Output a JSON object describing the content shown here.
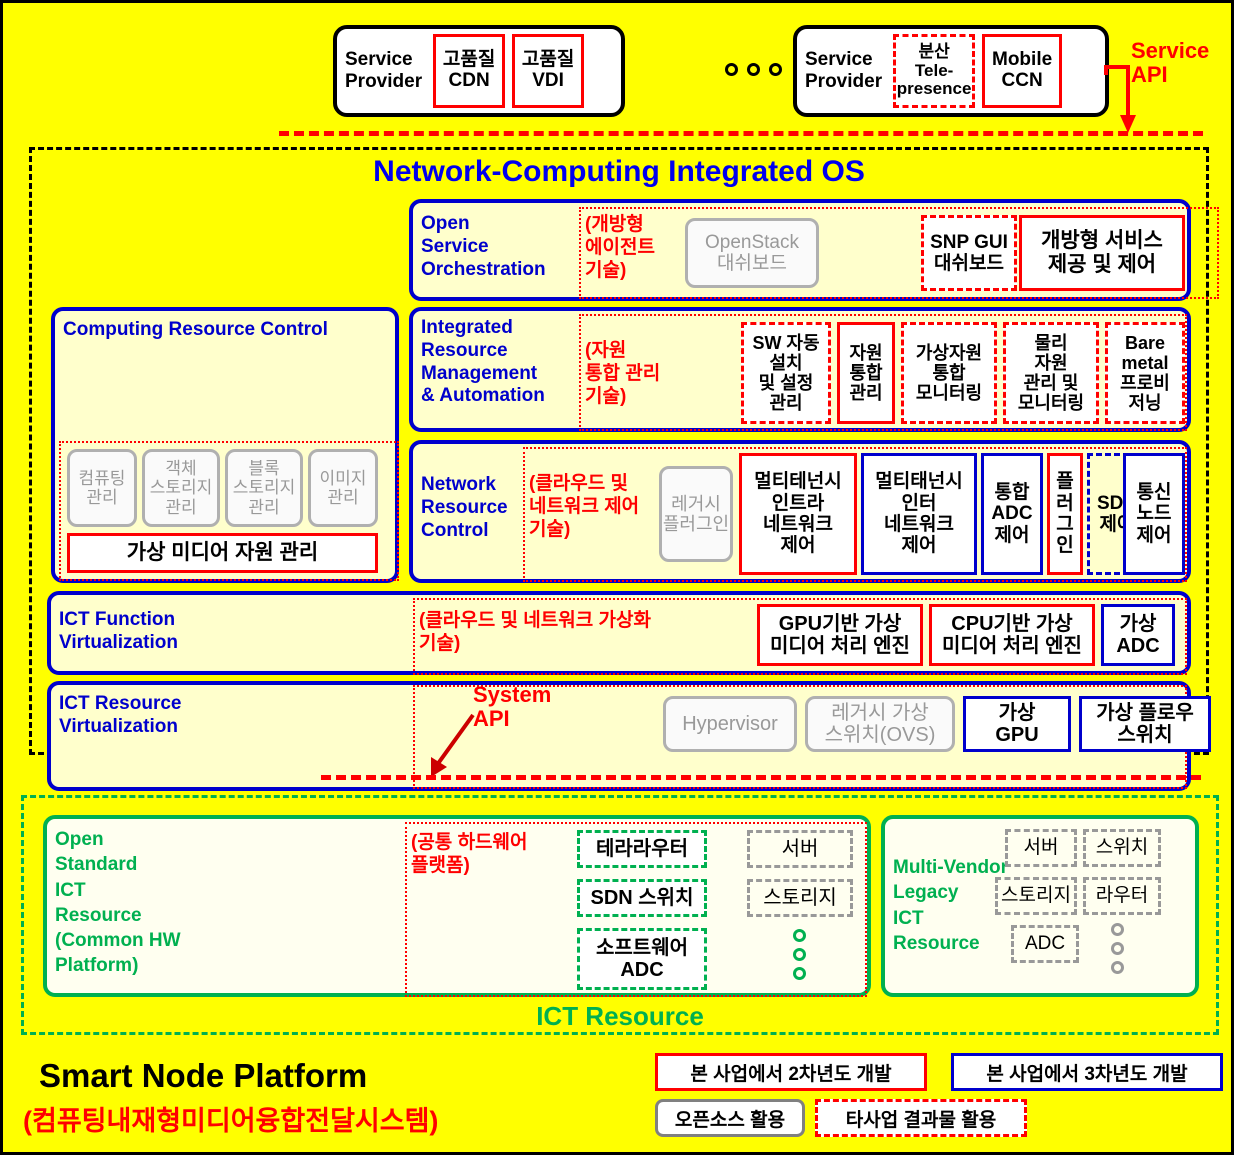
{
  "service_providers": [
    {
      "label": "Service\nProvider",
      "items": [
        {
          "text": "고품질\nCDN",
          "style": "red-solid"
        },
        {
          "text": "고품질\nVDI",
          "style": "red-solid"
        }
      ]
    },
    {
      "label": "Service\nProvider",
      "items": [
        {
          "text": "분산\nTele-\npresence",
          "style": "red-dashed"
        },
        {
          "text": "Mobile\nCCN",
          "style": "red-solid"
        }
      ]
    }
  ],
  "ellipsis": "○ ○ ○",
  "service_api_label": "Service\nAPI",
  "system_api_label": "System\nAPI",
  "os": {
    "title": "Network-Computing Integrated OS",
    "layers": {
      "open_service_orchestration": {
        "title": "Open\nService\nOrchestration",
        "note": "(개방형\n에이전트\n기술)",
        "items": [
          {
            "text": "OpenStack\n대쉬보드",
            "style": "gray"
          },
          {
            "text": "SNP GUI\n대쉬보드",
            "style": "red-dashed"
          },
          {
            "text": "개방형 서비스\n제공 및 제어",
            "style": "red-solid"
          }
        ]
      },
      "computing_resource_control": {
        "title": "Computing Resource Control",
        "items": [
          {
            "text": "컴퓨팅\n관리",
            "style": "gray"
          },
          {
            "text": "객체\n스토리지\n관리",
            "style": "gray"
          },
          {
            "text": "블록\n스토리지\n관리",
            "style": "gray"
          },
          {
            "text": "이미지\n관리",
            "style": "gray"
          }
        ],
        "wide_item": {
          "text": "가상 미디어 자원 관리",
          "style": "red-solid"
        }
      },
      "integrated_resource_management": {
        "title": "Integrated\nResource\nManagement\n& Automation",
        "note": "(자원\n통합 관리\n기술)",
        "items": [
          {
            "text": "SW 자동\n설치\n및 설정\n관리",
            "style": "red-dashed"
          },
          {
            "text": "자원\n통합\n관리",
            "style": "red-solid"
          },
          {
            "text": "가상자원\n통합\n모니터링",
            "style": "red-dashed"
          },
          {
            "text": "물리\n자원\n관리 및\n모니터링",
            "style": "red-dashed"
          },
          {
            "text": "Bare\nmetal\n프로비\n저닝",
            "style": "red-dashed"
          }
        ]
      },
      "network_resource_control": {
        "title": "Network\nResource\nControl",
        "note": "(클라우드 및\n네트워크 제어\n기술)",
        "items": [
          {
            "text": "레거시\n플러그인",
            "style": "gray"
          },
          {
            "text": "멀티테넌시\n인트라\n네트워크\n제어",
            "style": "red-solid"
          },
          {
            "text": "멀티태넌시\n인터\n네트워크\n제어",
            "style": "blue-solid"
          },
          {
            "text": "통합\nADC\n제어",
            "style": "blue-solid"
          },
          {
            "text": "플\n러\n그\n인",
            "style": "red-solid"
          },
          {
            "text": "SDN\n제어",
            "style": "blue-dashed"
          },
          {
            "text": "통신\n노드\n제어",
            "style": "blue-solid"
          }
        ]
      },
      "ict_function_virtualization": {
        "title": "ICT Function\nVirtualization",
        "note": "(클라우드 및 네트워크 가상화\n기술)",
        "items": [
          {
            "text": "GPU기반 가상\n미디어 처리 엔진",
            "style": "red-solid"
          },
          {
            "text": "CPU기반 가상\n미디어 처리 엔진",
            "style": "red-solid"
          },
          {
            "text": "가상\nADC",
            "style": "blue-solid"
          }
        ]
      },
      "ict_resource_virtualization": {
        "title": "ICT Resource\nVirtualization",
        "items": [
          {
            "text": "Hypervisor",
            "style": "gray"
          },
          {
            "text": "레거시 가상\n스위치(OVS)",
            "style": "gray"
          },
          {
            "text": "가상\nGPU",
            "style": "blue-solid"
          },
          {
            "text": "가상 플로우\n스위치",
            "style": "blue-solid"
          }
        ]
      }
    }
  },
  "ict_resource": {
    "caption": "ICT Resource",
    "open_standard": {
      "title": "Open\nStandard\nICT\nResource\n(Common HW\nPlatform)",
      "note": "(공통 하드웨어\n플랫폼)",
      "green_items": [
        {
          "text": "테라라우터"
        },
        {
          "text": "SDN 스위치"
        },
        {
          "text": "소프트웨어\nADC"
        }
      ],
      "gray_items": [
        {
          "text": "서버"
        },
        {
          "text": "스토리지"
        }
      ]
    },
    "multi_vendor": {
      "title": "Multi-Vendor\nLegacy\nICT\nResource",
      "gray_items": [
        {
          "text": "서버"
        },
        {
          "text": "스위치"
        },
        {
          "text": "스토리지"
        },
        {
          "text": "라우터"
        },
        {
          "text": "ADC"
        }
      ]
    }
  },
  "footer": {
    "title": "Smart Node Platform",
    "subtitle": "(컴퓨팅내재형미디어융합전달시스템)",
    "legend": [
      {
        "text": "본 사업에서 2차년도 개발",
        "style": "red-solid"
      },
      {
        "text": "본 사업에서 3차년도 개발",
        "style": "blue-solid"
      },
      {
        "text": "오픈소스 활용",
        "style": "gray-rounded"
      },
      {
        "text": "타사업 결과물 활용",
        "style": "red-dashed"
      }
    ]
  },
  "colors": {
    "background": "#ffff00",
    "red": "#ff0000",
    "blue": "#0000cc",
    "green": "#00b050",
    "gray": "#999999",
    "panel": "#ffffcc"
  }
}
